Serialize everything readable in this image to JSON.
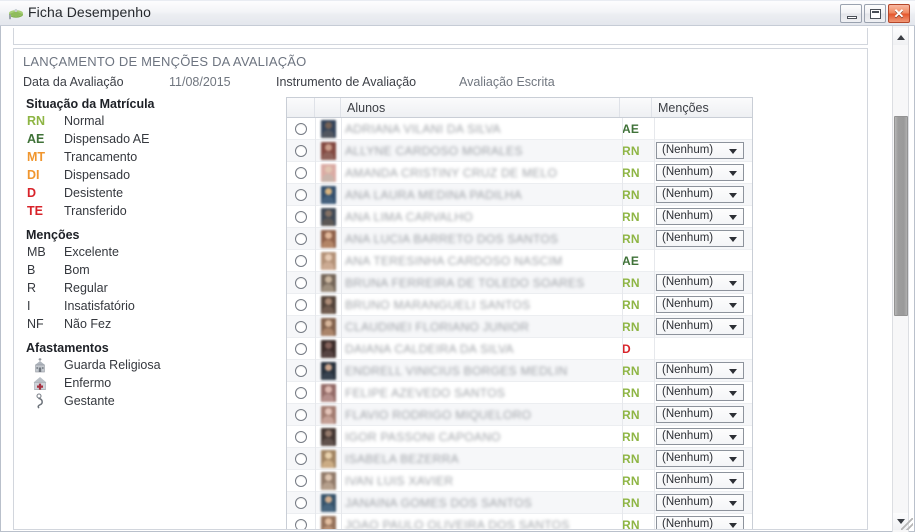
{
  "window": {
    "title": "Ficha Desempenho",
    "icon": "graduation-cap-icon",
    "minimize_label": "",
    "maximize_label": "",
    "close_label": "✕"
  },
  "panel": {
    "title": "LANÇAMENTO DE MENÇÕES DA AVALIAÇÃO",
    "date_label": "Data da Avaliação",
    "date_value": "11/08/2015",
    "instrument_label": "Instrumento de Avaliação",
    "instrument_value": "Avaliação Escrita"
  },
  "legend": {
    "situacao_title": "Situação da Matrícula",
    "situacao": [
      {
        "code": "RN",
        "label": "Normal",
        "color": "#8eb544"
      },
      {
        "code": "AE",
        "label": "Dispensado AE",
        "color": "#3f7238"
      },
      {
        "code": "MT",
        "label": "Trancamento",
        "color": "#f0962e"
      },
      {
        "code": "DI",
        "label": "Dispensado",
        "color": "#f0962e"
      },
      {
        "code": "D",
        "label": "Desistente",
        "color": "#d8232a"
      },
      {
        "code": "TE",
        "label": "Transferido",
        "color": "#d8232a"
      }
    ],
    "mencoes_title": "Menções",
    "mencoes": [
      {
        "code": "MB",
        "label": "Excelente"
      },
      {
        "code": "B",
        "label": "Bom"
      },
      {
        "code": "R",
        "label": "Regular"
      },
      {
        "code": "I",
        "label": "Insatisfatório"
      },
      {
        "code": "NF",
        "label": "Não Fez"
      }
    ],
    "afastamentos_title": "Afastamentos",
    "afastamentos": [
      {
        "icon": "church-icon",
        "label": "Guarda Religiosa"
      },
      {
        "icon": "medical-icon",
        "label": "Enfermo"
      },
      {
        "icon": "pregnant-icon",
        "label": "Gestante"
      }
    ]
  },
  "grid": {
    "columns": [
      "",
      "",
      "Alunos",
      "",
      "Menções"
    ],
    "dropdown_default": "(Nenhum)",
    "rows": [
      {
        "name": "ADRIANA VILANI DA SILVA",
        "status": "AE",
        "status_color": "#3f7238",
        "dropdown": null
      },
      {
        "name": "ALLYNE CARDOSO MORALES",
        "status": "RN",
        "status_color": "#8eb544",
        "dropdown": "(Nenhum)"
      },
      {
        "name": "AMANDA CRISTINY CRUZ DE MELO",
        "status": "RN",
        "status_color": "#8eb544",
        "dropdown": "(Nenhum)"
      },
      {
        "name": "ANA LAURA MEDINA PADILHA",
        "status": "RN",
        "status_color": "#8eb544",
        "dropdown": "(Nenhum)"
      },
      {
        "name": "ANA LIMA CARVALHO",
        "status": "RN",
        "status_color": "#8eb544",
        "dropdown": "(Nenhum)"
      },
      {
        "name": "ANA LUCIA BARRETO DOS SANTOS",
        "status": "RN",
        "status_color": "#8eb544",
        "dropdown": "(Nenhum)"
      },
      {
        "name": "ANA TERESINHA CARDOSO NASCIM",
        "status": "AE",
        "status_color": "#3f7238",
        "dropdown": null
      },
      {
        "name": "BRUNA FERREIRA DE TOLEDO SOARES",
        "status": "RN",
        "status_color": "#8eb544",
        "dropdown": "(Nenhum)"
      },
      {
        "name": "BRUNO MARANGUELI SANTOS",
        "status": "RN",
        "status_color": "#8eb544",
        "dropdown": "(Nenhum)"
      },
      {
        "name": "CLAUDINEI FLORIANO JUNIOR",
        "status": "RN",
        "status_color": "#8eb544",
        "dropdown": "(Nenhum)"
      },
      {
        "name": "DAIANA CALDEIRA DA SILVA",
        "status": "D",
        "status_color": "#d8232a",
        "dropdown": null
      },
      {
        "name": "ENDRELL VINICIUS BORGES MEDLIN",
        "status": "RN",
        "status_color": "#8eb544",
        "dropdown": "(Nenhum)"
      },
      {
        "name": "FELIPE AZEVEDO SANTOS",
        "status": "RN",
        "status_color": "#8eb544",
        "dropdown": "(Nenhum)"
      },
      {
        "name": "FLAVIO RODRIGO MIQUELORO",
        "status": "RN",
        "status_color": "#8eb544",
        "dropdown": "(Nenhum)"
      },
      {
        "name": "IGOR PASSONI CAPOANO",
        "status": "RN",
        "status_color": "#8eb544",
        "dropdown": "(Nenhum)"
      },
      {
        "name": "ISABELA BEZERRA",
        "status": "RN",
        "status_color": "#8eb544",
        "dropdown": "(Nenhum)"
      },
      {
        "name": "IVAN LUIS XAVIER",
        "status": "RN",
        "status_color": "#8eb544",
        "dropdown": "(Nenhum)"
      },
      {
        "name": "JANAINA GOMES DOS SANTOS",
        "status": "RN",
        "status_color": "#8eb544",
        "dropdown": "(Nenhum)"
      },
      {
        "name": "JOAO PAULO OLIVEIRA DOS SANTOS",
        "status": "RN",
        "status_color": "#8eb544",
        "dropdown": "(Nenhum)"
      }
    ]
  },
  "scrollbar": {
    "up_arrow": "scroll-up-icon",
    "down_arrow": "scroll-down-icon"
  }
}
